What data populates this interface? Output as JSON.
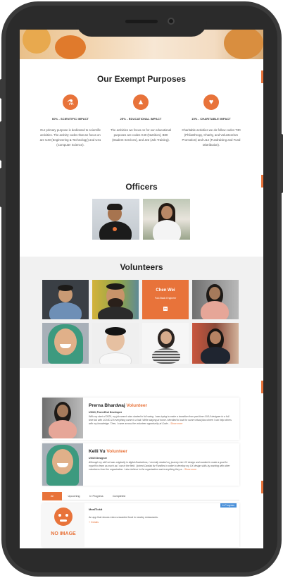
{
  "purposes": {
    "title": "Our Exempt Purposes",
    "items": [
      {
        "icon": "flask-icon",
        "title": "60% - SCIENTIFIC IMPACT",
        "description": "Our primary purpose is dedicated to scientific activities. The activity codes that we focus on are U40 (Engineering & Technology) and U41 (Computer Science)."
      },
      {
        "icon": "graduation-cap-icon",
        "title": "25% - EDUCATIONAL IMPACT",
        "description": "The activities we focus on for our educational purposes are codes K40 (Nutrition), B80 (Student Services), and J22 (Job Training)."
      },
      {
        "icon": "heart-icon",
        "title": "15% - CHARITABLE IMPACT",
        "description": "Charitable activities we do follow codes T30 (Philanthropy, Charity, and Volunteerism Promotion) and U12 (Fundraising and Fund Distribution)."
      }
    ]
  },
  "officers": {
    "title": "Officers"
  },
  "volunteers": {
    "title": "Volunteers",
    "highlight": {
      "name": "Chen Wei",
      "role": "Full-Stack Engineer",
      "icon": "linkedin-icon"
    }
  },
  "cards": [
    {
      "name": "Prerna Bhardwaj",
      "role": "Volunteer",
      "subtitle": "UX/UI, Front-End Developer",
      "description": "With my start of 2020, my job search also started in full swing. I was trying to make a transition from part-time UX/UI designer to a full-time but with COVID-19 everything came to a halt. While staying at home I decided to look for some virtual jobs where I can help others with my knowledge. Then, I came across the volunteer opportunity at Code...",
      "more": "Show more"
    },
    {
      "name": "Kelli Vu",
      "role": "Volunteer",
      "subtitle": "UX/UI Designer",
      "description": "Although my skill set was originally in digital illustrations, I recently started my journey into UX design and wanted to make a goal for myself to learn as much as I can in the field. I joined Cardab for Families in order to develop my UX design skills by working with other volunteers from the organization. I also believe in the organization and everything they a...",
      "more": "Show more"
    }
  ],
  "tabs": [
    "All",
    "Upcoming",
    "In Progress",
    "Completed"
  ],
  "project": {
    "name": "MealTickit",
    "badge": "In Progress",
    "description": "An app that shows extra unwanted food in nearby restaurants.",
    "link": "+ Details",
    "image_text": "NO IMAGE"
  },
  "colors": {
    "accent": "#e8733a",
    "frame": "#3a3a3a",
    "section_bg": "#f1f1f1"
  }
}
